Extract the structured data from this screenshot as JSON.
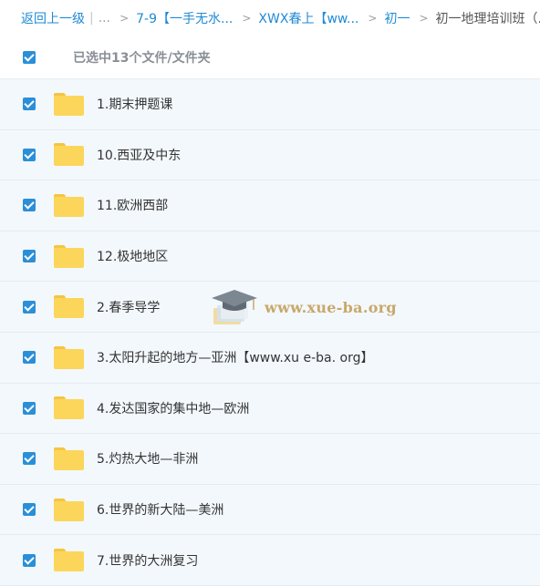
{
  "breadcrumb": {
    "back": "返回上一级",
    "ellipsis": "...",
    "items": [
      "7-9【一手无水...",
      "XWX春上【ww...",
      "初一"
    ],
    "current": "初一地理培训班（..."
  },
  "selection": {
    "checked": true,
    "label": "已选中13个文件/文件夹"
  },
  "files": [
    {
      "name": "1.期末押题课",
      "checked": true
    },
    {
      "name": "10.西亚及中东",
      "checked": true
    },
    {
      "name": "11.欧洲西部",
      "checked": true
    },
    {
      "name": "12.极地地区",
      "checked": true
    },
    {
      "name": "2.春季导学",
      "checked": true
    },
    {
      "name": "3.太阳升起的地方—亚洲【www.xu e-ba. org】",
      "checked": true
    },
    {
      "name": "4.发达国家的集中地—欧洲",
      "checked": true
    },
    {
      "name": "5.灼热大地—非洲",
      "checked": true
    },
    {
      "name": "6.世界的新大陆—美洲",
      "checked": true
    },
    {
      "name": "7.世界的大洲复习",
      "checked": true
    }
  ],
  "watermark": {
    "text": "www.xue-ba.org"
  },
  "colors": {
    "accent": "#2b8fd8",
    "link": "#1f8ad6",
    "row_bg": "#f3f8fc",
    "folder": "#fcd65a"
  }
}
